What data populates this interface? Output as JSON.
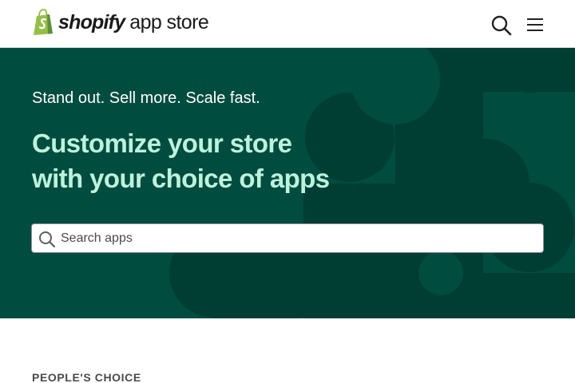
{
  "header": {
    "logo_word": "shopify",
    "logo_sub": "app store",
    "logo_icon": "shopify-bag-icon",
    "search_icon": "search-icon",
    "menu_icon": "hamburger-menu-icon"
  },
  "hero": {
    "tagline": "Stand out. Sell more. Scale fast.",
    "title_line1": "Customize your store",
    "title_line2": "with your choice of apps",
    "search": {
      "placeholder": "Search apps",
      "value": ""
    }
  },
  "section": {
    "label": "PEOPLE'S CHOICE"
  },
  "colors": {
    "hero_bg": "#004c3f",
    "hero_shape": "#003d33",
    "hero_title": "#bdf2dc",
    "brand_green": "#95bf47",
    "brand_green_dark": "#5e8e3e"
  }
}
